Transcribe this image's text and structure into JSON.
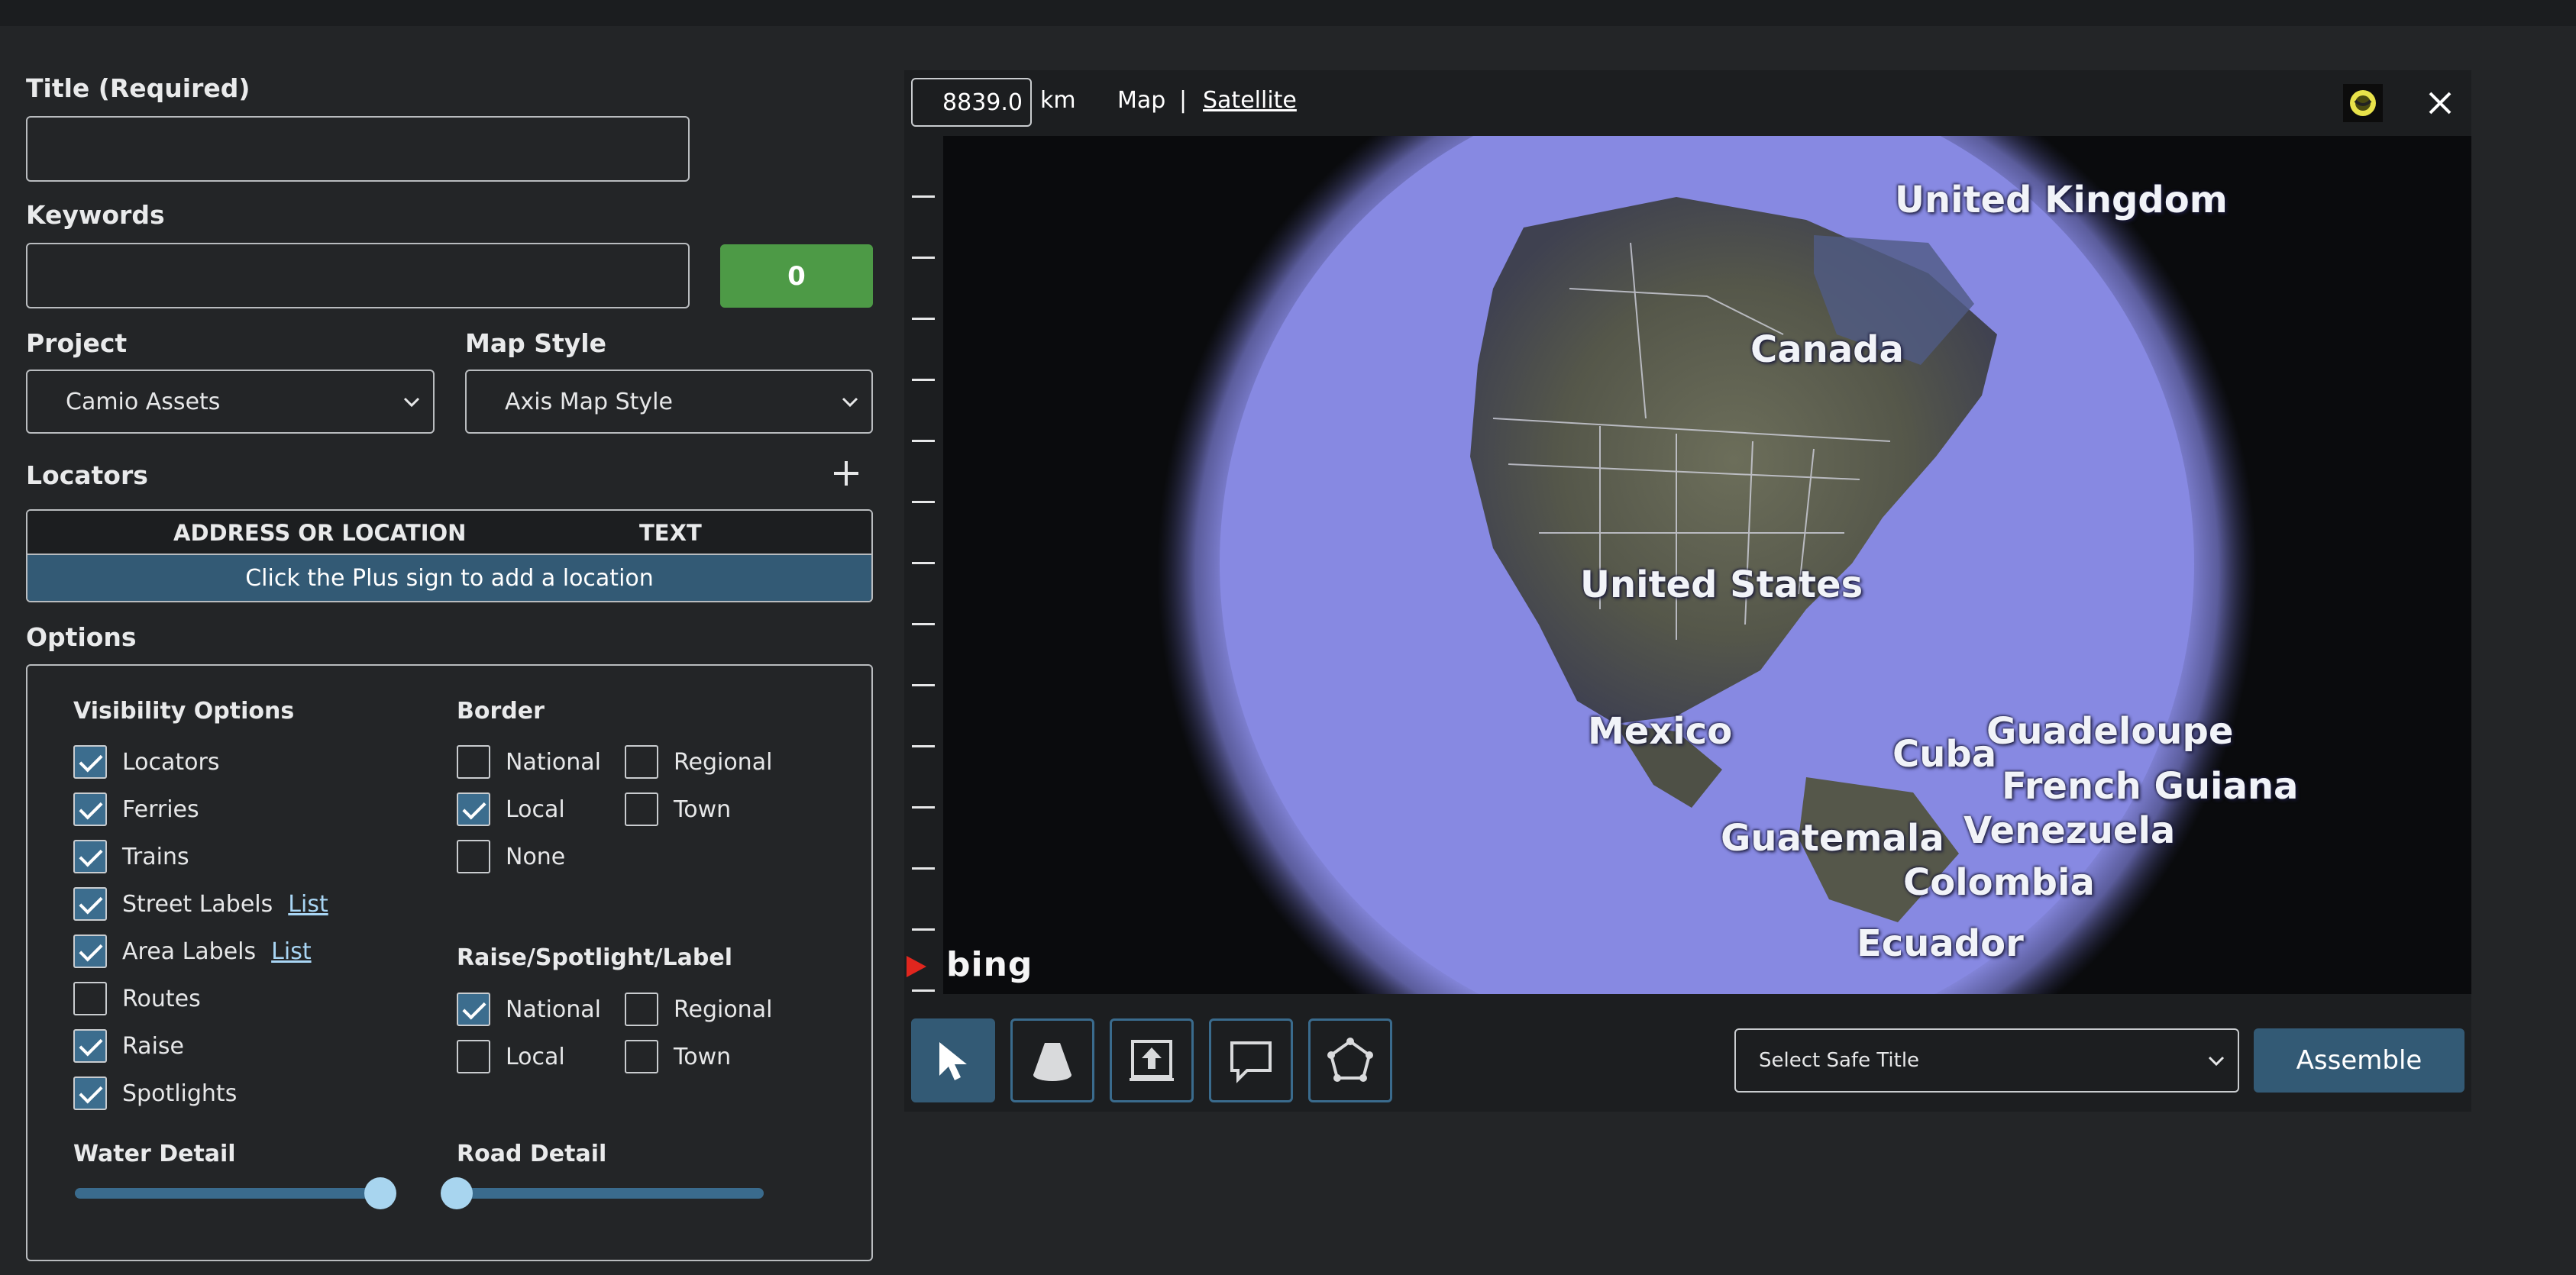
{
  "form": {
    "title_label": "Title (Required)",
    "title_value": "",
    "keywords_label": "Keywords",
    "keywords_value": "",
    "keyword_count": "0",
    "project_label": "Project",
    "project_value": "Camio Assets",
    "map_style_label": "Map Style",
    "map_style_value": "Axis Map Style"
  },
  "locators": {
    "label": "Locators",
    "col_address": "ADDRESS OR LOCATION",
    "col_text": "TEXT",
    "empty_message": "Click the Plus sign to add a location"
  },
  "options": {
    "label": "Options",
    "visibility": {
      "label": "Visibility Options",
      "items": [
        {
          "label": "Locators",
          "checked": true
        },
        {
          "label": "Ferries",
          "checked": true
        },
        {
          "label": "Trains",
          "checked": true
        },
        {
          "label": "Street Labels",
          "checked": true,
          "link": "List"
        },
        {
          "label": "Area Labels",
          "checked": true,
          "link": "List"
        },
        {
          "label": "Routes",
          "checked": false
        },
        {
          "label": "Raise",
          "checked": true
        },
        {
          "label": "Spotlights",
          "checked": true
        }
      ]
    },
    "border": {
      "label": "Border",
      "national": {
        "label": "National",
        "checked": false
      },
      "regional": {
        "label": "Regional",
        "checked": false
      },
      "local": {
        "label": "Local",
        "checked": true
      },
      "town": {
        "label": "Town",
        "checked": false
      },
      "none": {
        "label": "None",
        "checked": false
      }
    },
    "raise": {
      "label": "Raise/Spotlight/Label",
      "national": {
        "label": "National",
        "checked": true
      },
      "regional": {
        "label": "Regional",
        "checked": false
      },
      "local": {
        "label": "Local",
        "checked": false
      },
      "town": {
        "label": "Town",
        "checked": false
      }
    },
    "water_detail": {
      "label": "Water Detail",
      "level": 1.0
    },
    "road_detail": {
      "label": "Road Detail",
      "level": 0.0
    }
  },
  "map": {
    "zoom_value": "8839.0",
    "zoom_unit": "km",
    "mode_map": "Map",
    "mode_separator": "|",
    "mode_satellite": "Satellite",
    "bing": "bing",
    "countries": {
      "uk": "United Kingdom",
      "canada": "Canada",
      "us": "United States",
      "mexico": "Mexico",
      "cuba": "Cuba",
      "guadeloupe": "Guadeloupe",
      "french_guiana": "French Guiana",
      "venezuela": "Venezuela",
      "guatemala": "Guatemala",
      "colombia": "Colombia",
      "ecuador": "Ecuador"
    },
    "safe_title_placeholder": "Select Safe Title",
    "assemble_label": "Assemble",
    "colors": {
      "accent": "#335a75",
      "success": "#4d9a46",
      "globe": "#8d8fe8"
    }
  }
}
